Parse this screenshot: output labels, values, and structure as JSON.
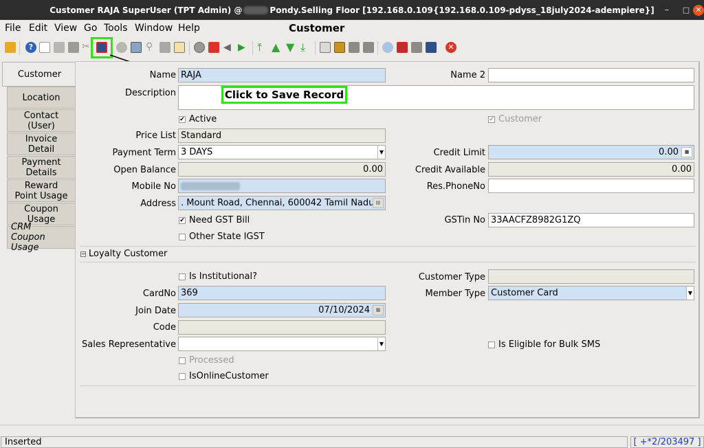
{
  "titlebar": {
    "text_left": "Customer  RAJA  SuperUser (TPT Admin) @",
    "text_right": "Pondy.Selling Floor [192.168.0.109{192.168.0.109-pdyss_18july2024-adempiere}]"
  },
  "menu": {
    "file": "File",
    "edit": "Edit",
    "view": "View",
    "go": "Go",
    "tools": "Tools",
    "window": "Window",
    "help": "Help"
  },
  "window_title": "Customer",
  "tabs": [
    {
      "label": "Customer"
    },
    {
      "label": "Location"
    },
    {
      "label1": "Contact",
      "label2": "(User)"
    },
    {
      "label1": "Invoice",
      "label2": "Detail"
    },
    {
      "label1": "Payment",
      "label2": "Details"
    },
    {
      "label1": "Reward",
      "label2": "Point Usage"
    },
    {
      "label1": "Coupon",
      "label2": "Usage"
    },
    {
      "label1": "CRM",
      "label2": "Coupon Usage"
    }
  ],
  "annotation": {
    "text": "Click to Save Record",
    "color": "#33e11b"
  },
  "form": {
    "name_label": "Name",
    "name_value": "RAJA",
    "name2_label": "Name 2",
    "name2_value": "",
    "description_label": "Description",
    "description_value": "",
    "active_label": "Active",
    "customer_label": "Customer",
    "pricelist_label": "Price List",
    "pricelist_value": "Standard",
    "paymentterm_label": "Payment Term",
    "paymentterm_value": "3 DAYS",
    "creditlimit_label": "Credit Limit",
    "creditlimit_value": "0.00",
    "openbalance_label": "Open Balance",
    "openbalance_value": "0.00",
    "creditavailable_label": "Credit Available",
    "creditavailable_value": "0.00",
    "mobile_label": "Mobile No",
    "resphone_label": "Res.PhoneNo",
    "resphone_value": "",
    "address_label": "Address",
    "address_value": ". Mount Road, Chennai,  600042 Tamil Nadu",
    "needgst_label": "Need GST Bill",
    "gstin_label": "GSTin No",
    "gstin_value": "33AACFZ8982G1ZQ",
    "otherstate_label": "Other State IGST"
  },
  "loyalty": {
    "section_label": "Loyalty Customer",
    "institutional_label": "Is Institutional?",
    "customertype_label": "Customer Type",
    "customertype_value": "",
    "cardno_label": "CardNo",
    "cardno_value": "369",
    "membertype_label": "Member Type",
    "membertype_value": "Customer Card",
    "joindate_label": "Join Date",
    "joindate_value": "07/10/2024",
    "code_label": "Code",
    "code_value": "",
    "salesrep_label": "Sales Representative",
    "salesrep_value": "",
    "bulksms_label": "Is Eligible for Bulk SMS",
    "processed_label": "Processed",
    "online_label": "IsOnlineCustomer"
  },
  "status": {
    "text": "Inserted",
    "record": "[ +*2/203497 ]"
  },
  "colors": {
    "field_blue": "#cfe1f3",
    "readonly": "#ebe9df",
    "titlebar": "#2d2d2d"
  }
}
